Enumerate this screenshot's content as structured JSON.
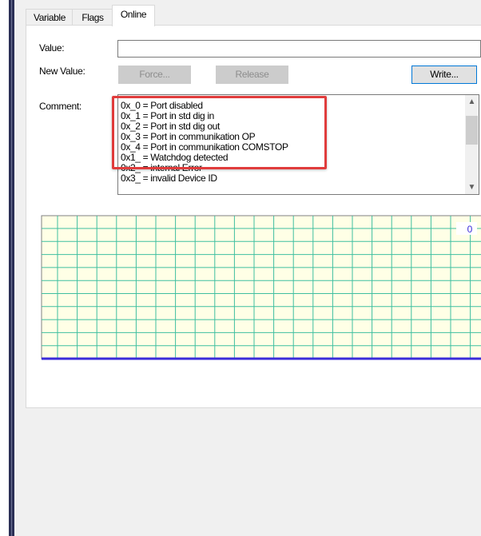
{
  "tabs": [
    {
      "label": "Variable"
    },
    {
      "label": "Flags"
    },
    {
      "label": "Online"
    }
  ],
  "online": {
    "value_label": "Value:",
    "value": "",
    "new_value_label": "New Value:",
    "force_label": "Force...",
    "release_label": "Release",
    "write_label": "Write...",
    "comment_label": "Comment:",
    "comment_lines": [
      "0x_0 = Port disabled",
      "0x_1 = Port in std dig in",
      "0x_2 = Port in std dig out",
      "0x_3 = Port in communikation OP",
      "0x_4 = Port in communikation COMSTOP",
      "0x1_ = Watchdog detected",
      "0x2_ = internal Error",
      "0x3_ = invalid Device ID"
    ]
  },
  "chart_data": {
    "type": "line",
    "title": "",
    "y_tick_label": "0",
    "series": [
      {
        "values": [
          0,
          0
        ]
      }
    ],
    "grid": true,
    "colors": {
      "background": "#ffffe6",
      "grid": "#3fbfa0",
      "line": "#3a2bd9"
    }
  },
  "colors": {
    "highlight": "#e03c3c",
    "focus_border": "#0078d7"
  }
}
